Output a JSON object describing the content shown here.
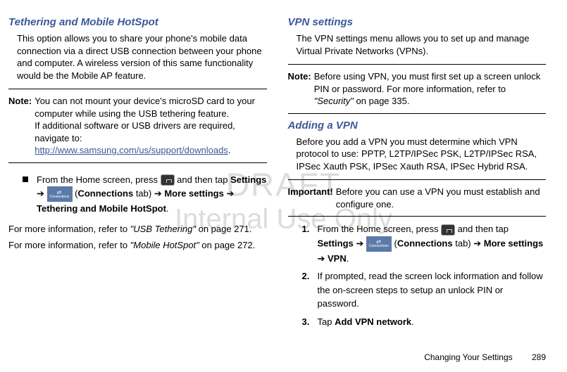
{
  "left": {
    "heading": "Tethering and Mobile HotSpot",
    "intro": "This option allows you to share your phone's mobile data connection via a direct USB connection between your phone and computer. A wireless version of this same functionality would be the Mobile AP feature.",
    "note_label": "Note:",
    "note_text1": "You can not mount your device's microSD card to your computer while using the USB tethering feature.",
    "note_text2": "If additional software or USB drivers are required, navigate to: ",
    "note_link": "http://www.samsung.com/us/support/downloads",
    "note_period": ".",
    "bullet_pre": "From the Home screen, press ",
    "bullet_mid1": " and then tap ",
    "bullet_settings": "Settings",
    "arrow": " ➔ ",
    "conn_tab_open": " (",
    "conn_tab": "Connections",
    "conn_tab_close": " tab) ",
    "more_settings": "More settings",
    "tether_hotspot": "Tethering and Mobile HotSpot",
    "period": ".",
    "ref1_pre": "For more information, refer to ",
    "ref1_title": "\"USB Tethering\"",
    "ref1_post": "  on page 271.",
    "ref2_pre": "For more information, refer to ",
    "ref2_title": "\"Mobile HotSpot\"",
    "ref2_post": "  on page 272."
  },
  "right": {
    "heading1": "VPN settings",
    "intro1": "The VPN settings menu allows you to set up and manage Virtual Private Networks (VPNs).",
    "note_label": "Note:",
    "note_text_pre": "Before using VPN, you must first set up a screen unlock PIN or password. For more information, refer to ",
    "note_ref": "\"Security\"",
    "note_text_post": "  on page 335.",
    "heading2": "Adding a VPN",
    "intro2": "Before you add a VPN you must determine which VPN protocol to use: PPTP, L2TP/IPSec PSK, L2TP/IPSec RSA, IPSec Xauth PSK, IPSec Xauth RSA, IPSec Hybrid RSA.",
    "important_label": "Important!",
    "important_text": "Before you can use a VPN you must establish and configure one.",
    "step1_num": "1.",
    "step1_pre": "From the Home screen, press ",
    "step1_mid": " and then tap ",
    "step1_settings": "Settings",
    "arrow": " ➔ ",
    "conn_tab_open": " (",
    "conn_tab": "Connections",
    "conn_tab_close": " tab) ",
    "more_settings": "More settings",
    "vpn": "VPN",
    "period": ".",
    "step2_num": "2.",
    "step2_text": "If prompted, read the screen lock information and follow the on-screen steps to setup an unlock PIN or password.",
    "step3_num": "3.",
    "step3_pre": "Tap ",
    "step3_bold": "Add VPN network",
    "step3_post": "."
  },
  "watermark": {
    "line1": "DRAFT",
    "line2": "Internal Use Only"
  },
  "footer": {
    "section": "Changing Your Settings",
    "page": "289"
  },
  "conn_label": "Connections"
}
